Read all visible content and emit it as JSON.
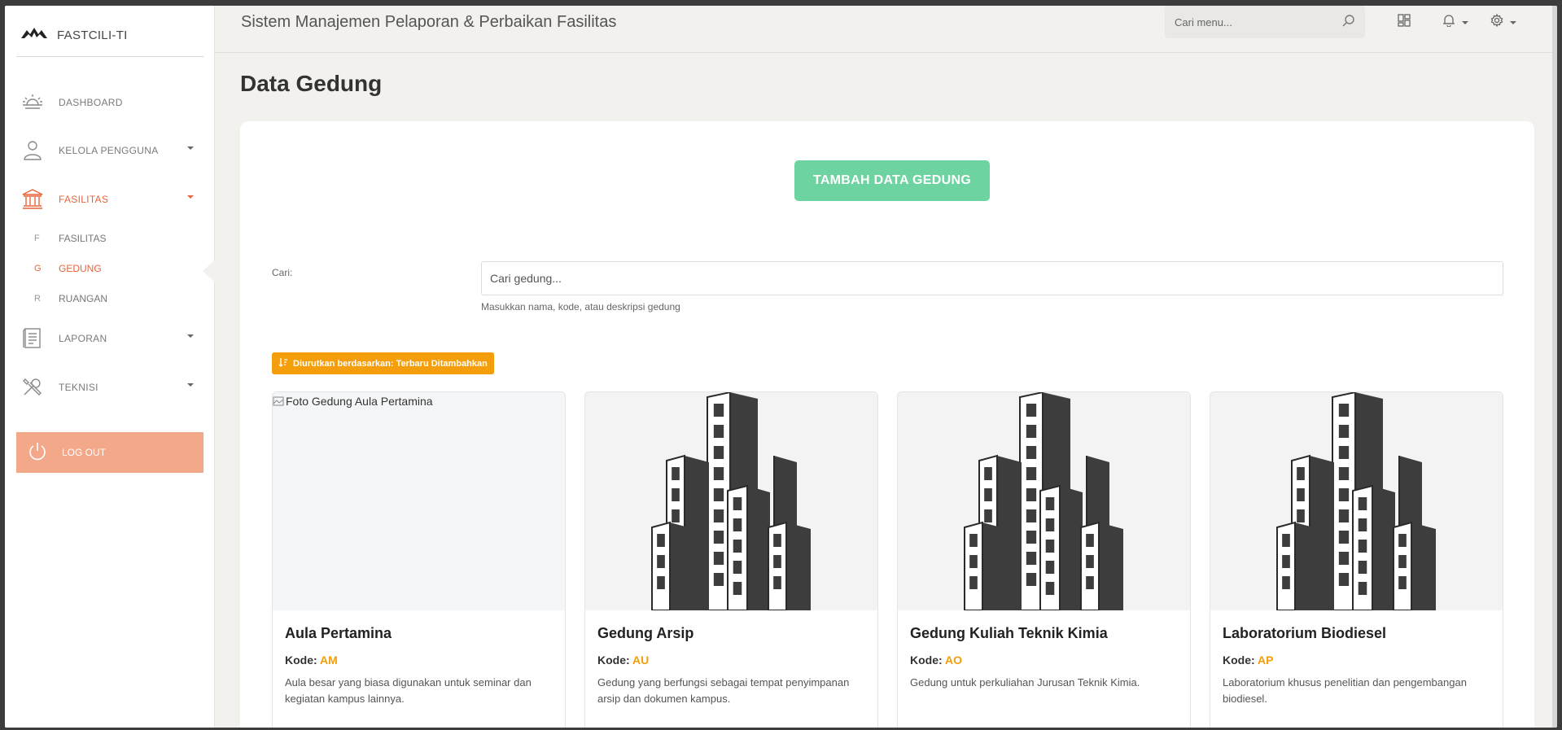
{
  "brand": {
    "name": "FASTCILI-TI"
  },
  "sidebar": {
    "items": [
      {
        "label": "DASHBOARD",
        "icon": "sunrise-icon"
      },
      {
        "label": "KELOLA PENGGUNA",
        "icon": "user-icon"
      },
      {
        "label": "FASILITAS",
        "icon": "bank-icon"
      },
      {
        "label": "LAPORAN",
        "icon": "document-icon"
      },
      {
        "label": "TEKNISI",
        "icon": "tools-icon"
      }
    ],
    "sub_items": [
      {
        "letter": "F",
        "label": "FASILITAS"
      },
      {
        "letter": "G",
        "label": "GEDUNG"
      },
      {
        "letter": "R",
        "label": "RUANGAN"
      }
    ],
    "logout": "LOG OUT"
  },
  "topbar": {
    "title": "Sistem Manajemen Pelaporan & Perbaikan Fasilitas",
    "search_placeholder": "Cari menu..."
  },
  "main": {
    "page_title": "Data Gedung",
    "add_button": "TAMBAH DATA GEDUNG",
    "search_label": "Cari:",
    "search_placeholder": "Cari gedung...",
    "search_help": "Masukkan nama, kode, atau deskripsi gedung",
    "sort_badge": "Diurutkan berdasarkan: Terbaru Ditambahkan",
    "kode_label": "Kode:",
    "buildings": [
      {
        "name": "Aula Pertamina",
        "code": "AM",
        "description": "Aula besar yang biasa digunakan untuk seminar dan kegiatan kampus lainnya.",
        "image_alt": "Foto Gedung Aula Pertamina"
      },
      {
        "name": "Gedung Arsip",
        "code": "AU",
        "description": "Gedung yang berfungsi sebagai tempat penyimpanan arsip dan dokumen kampus."
      },
      {
        "name": "Gedung Kuliah Teknik Kimia",
        "code": "AO",
        "description": "Gedung untuk perkuliahan Jurusan Teknik Kimia."
      },
      {
        "name": "Laboratorium Biodiesel",
        "code": "AP",
        "description": "Laboratorium khusus penelitian dan pengembangan biodiesel."
      }
    ]
  },
  "colors": {
    "accent": "#e8643c",
    "logout_bg": "#f3a88a",
    "add_button_bg": "#6dd3a0",
    "badge_bg": "#f59e0b",
    "code_color": "#f59e0b"
  }
}
